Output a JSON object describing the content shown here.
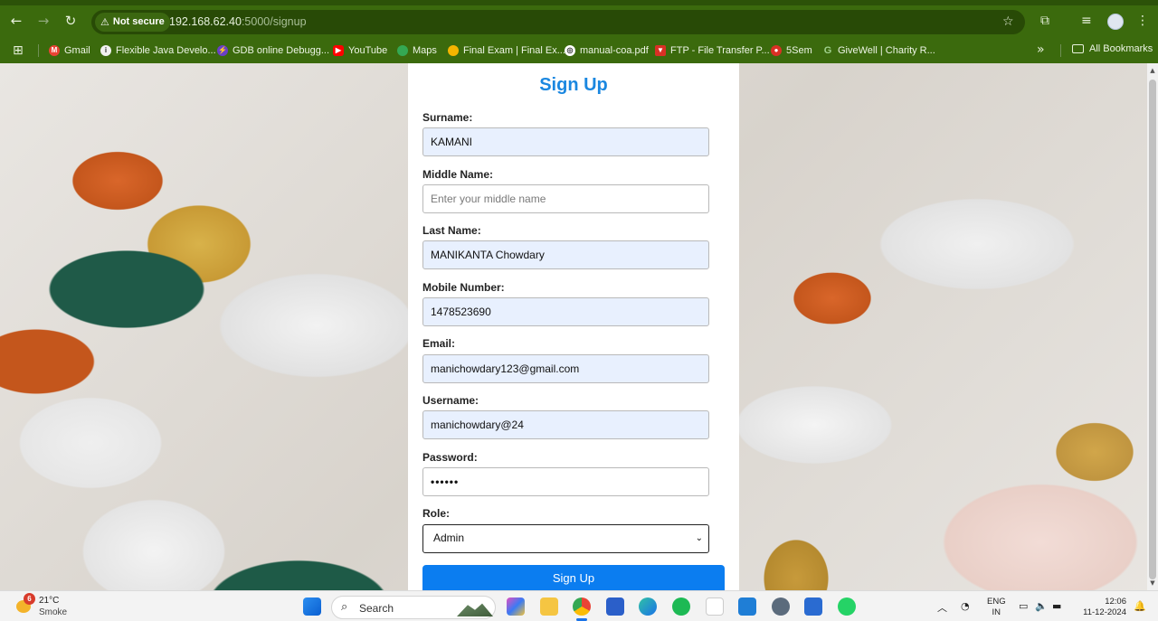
{
  "browser": {
    "security_label": "Not secure",
    "url_host": "192.168.62.40",
    "url_rest": ":5000/signup",
    "bookmarks": [
      {
        "label": "Gmail",
        "color": "#ea4335"
      },
      {
        "label": "Flexible Java Develo...",
        "color": "#5f6368"
      },
      {
        "label": "GDB online Debugg...",
        "color": "#6a3fc7"
      },
      {
        "label": "YouTube",
        "color": "#ff0000"
      },
      {
        "label": "Maps",
        "color": "#34a853"
      },
      {
        "label": "Final Exam | Final Ex...",
        "color": "#f4b400"
      },
      {
        "label": "manual-coa.pdf",
        "color": "#ffffff"
      },
      {
        "label": "FTP - File Transfer P...",
        "color": "#d93025"
      },
      {
        "label": "5Sem",
        "color": "#d93025"
      },
      {
        "label": "GiveWell | Charity R...",
        "color": "#34a853"
      }
    ],
    "all_bookmarks": "All Bookmarks"
  },
  "form": {
    "title": "Sign Up",
    "surname_label": "Surname:",
    "surname_value": "KAMANI",
    "middle_label": "Middle Name:",
    "middle_placeholder": "Enter your middle name",
    "last_label": "Last Name:",
    "last_value": "MANIKANTA Chowdary",
    "mobile_label": "Mobile Number:",
    "mobile_value": "1478523690",
    "email_label": "Email:",
    "email_value": "manichowdary123@gmail.com",
    "username_label": "Username:",
    "username_value": "manichowdary@24",
    "password_label": "Password:",
    "password_mask": "••••••",
    "role_label": "Role:",
    "role_value": "Admin",
    "submit_label": "Sign Up"
  },
  "taskbar": {
    "weather_badge": "6",
    "weather_temp": "21°C",
    "weather_desc": "Smoke",
    "search_label": "Search",
    "lang_line1": "ENG",
    "lang_line2": "IN",
    "time": "12:06",
    "date": "11-12-2024"
  },
  "colors": {
    "accent": "#1a87e0",
    "button": "#0b7df0",
    "browser_chrome": "#3b6a0d"
  }
}
